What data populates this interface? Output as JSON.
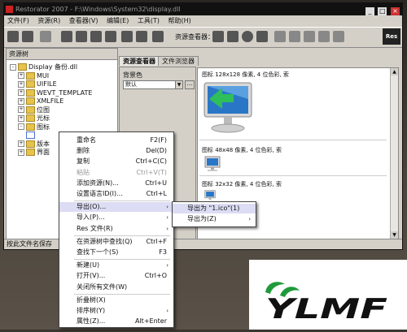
{
  "window": {
    "title": "Restorator 2007 - F:\\Windows\\System32\\display.dll",
    "controls": [
      "_",
      "□",
      "×"
    ]
  },
  "menubar": [
    "文件(F)",
    "资源(R)",
    "查看器(V)",
    "编辑(E)",
    "工具(T)",
    "帮助(H)"
  ],
  "toolbar": {
    "resource_label": "资源查看器：",
    "logo_text": "Res"
  },
  "left_pane": {
    "title": "资源树",
    "tree": [
      {
        "label": "Display 备份.dll",
        "level": 0,
        "expander": "-"
      },
      {
        "label": "MUI",
        "level": 1,
        "expander": "+"
      },
      {
        "label": "UIFILE",
        "level": 1,
        "expander": "+"
      },
      {
        "label": "WEVT_TEMPLATE",
        "level": 1,
        "expander": "+"
      },
      {
        "label": "XMLFILE",
        "level": 1,
        "expander": "+"
      },
      {
        "label": "位图",
        "level": 1,
        "expander": "+"
      },
      {
        "label": "光标",
        "level": 1,
        "expander": "+"
      },
      {
        "label": "图标",
        "level": 1,
        "expander": "-"
      },
      {
        "label": "",
        "level": 2,
        "expander": ""
      },
      {
        "label": "版本",
        "level": 1,
        "expander": "+"
      },
      {
        "label": "界面",
        "level": 1,
        "expander": "+"
      }
    ]
  },
  "tabs": [
    "资源查看器",
    "文件浏览器"
  ],
  "mid_pane": {
    "label": "背景色",
    "dropdown_value": "默认",
    "button_label": "..."
  },
  "right_pane": {
    "icon_headers": [
      "图标 128x128 像素, 4 位色彩, 索",
      "图标 48x48 像素, 4 位色彩, 索",
      "图标 32x32 像素, 4 位色彩, 索"
    ]
  },
  "status_bar": "按此文件名保存",
  "context_menu": [
    {
      "label": "重命名",
      "shortcut": "F2(F)",
      "disabled": false
    },
    {
      "label": "删除",
      "shortcut": "Del(D)",
      "disabled": false
    },
    {
      "label": "复制",
      "shortcut": "Ctrl+C(C)",
      "disabled": false
    },
    {
      "label": "粘贴",
      "shortcut": "Ctrl+V(T)",
      "disabled": true
    },
    {
      "label": "添加资源(N)...",
      "shortcut": "Ctrl+U",
      "disabled": false
    },
    {
      "label": "设置语言ID(I)...",
      "shortcut": "Ctrl+L",
      "disabled": false
    },
    {
      "label": "导出(O)...",
      "shortcut": "",
      "arrow": "›",
      "highlighted": true
    },
    {
      "label": "导入(P)...",
      "shortcut": "",
      "arrow": "›"
    },
    {
      "label": "Res 文件(R)",
      "shortcut": "",
      "arrow": "›"
    },
    {
      "label": "在资源树中查找(Q)",
      "shortcut": "Ctrl+F"
    },
    {
      "label": "查找下一个(S)",
      "shortcut": "F3"
    },
    {
      "label": "新建(U)",
      "shortcut": "",
      "arrow": "›"
    },
    {
      "label": "打开(V)...",
      "shortcut": "Ctrl+O"
    },
    {
      "label": "关闭所有文件(W)",
      "shortcut": ""
    },
    {
      "label": "折叠树(X)",
      "shortcut": ""
    },
    {
      "label": "排序树(Y)",
      "shortcut": "",
      "arrow": "›"
    },
    {
      "label": "属性(Z)...",
      "shortcut": "Alt+Enter"
    }
  ],
  "submenu": [
    {
      "label": "导出为 \"1.ico\"(1)",
      "arrow": ""
    },
    {
      "label": "导出为(Z)",
      "arrow": "›"
    }
  ],
  "brand": {
    "name": "YLMF"
  },
  "colors": {
    "brand_green": "#1f9a3a",
    "brand_black": "#111111",
    "menu_highlight": "#dcdcf4"
  }
}
